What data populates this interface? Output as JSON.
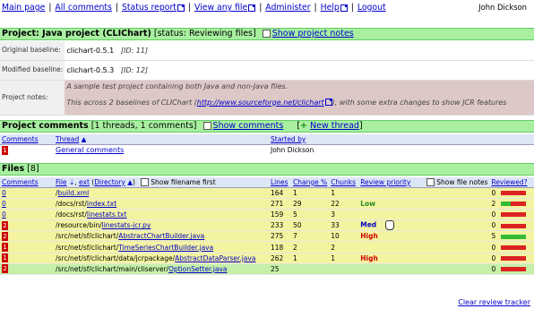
{
  "nav": {
    "items": [
      "Main page",
      "All comments",
      "Status report",
      "View any file",
      "Administer",
      "Help",
      "Logout"
    ],
    "user": "John Dickson"
  },
  "project": {
    "header_prefix": "Project: ",
    "name": "Java project (CLIChart)",
    "status": "[status: Reviewing files]",
    "show_notes": "Show project notes",
    "original_label": "Original baseline:",
    "original_value": "clichart-0.5.1",
    "original_id": "[ID: 11]",
    "modified_label": "Modified baseline:",
    "modified_value": "clichart-0.5.3",
    "modified_id": "[ID: 12]",
    "notes_label": "Project notes:",
    "notes_line1": "A sample test project containing both Java and non-Java files.",
    "notes_line2_pre": "This across 2 baselines of CLIChart (",
    "notes_link": "http://www.sourceforge.net/clichart",
    "notes_line2_post": "), with some extra changes to show JCR features"
  },
  "comments": {
    "title": "Project comments",
    "count": "[1 threads, 1 comments]",
    "show": "Show comments",
    "new_thread": "New thread",
    "col_comments": "Comments",
    "col_thread": "Thread",
    "col_started": "Started by",
    "rows": [
      {
        "count": "1",
        "thread": "General comments",
        "started_by": "John Dickson"
      }
    ]
  },
  "files": {
    "title": "Files",
    "count": "[8]",
    "col_comments": "Comments",
    "col_file": "File",
    "col_ext": "ext",
    "col_directory": "Directory",
    "show_filename_first": "Show filename first",
    "col_lines": "Lines",
    "col_change": "Change %",
    "col_chunks": "Chunks",
    "col_priority": "Review priority",
    "show_file_notes": "Show file notes",
    "col_reviewed": "Reviewed?",
    "rows": [
      {
        "comments": "0",
        "dir": "/",
        "file": "build.xml",
        "lines": "164",
        "change": "1",
        "chunks": "1",
        "priority": "",
        "reviewed": "0",
        "fill": 0,
        "green": false
      },
      {
        "comments": "0",
        "dir": "/docs/rst/",
        "file": "index.txt",
        "lines": "271",
        "change": "29",
        "chunks": "22",
        "priority": "Low",
        "reviewed": "2",
        "fill": 0.4,
        "green": false
      },
      {
        "comments": "0",
        "dir": "/docs/rst/",
        "file": "linestats.txt",
        "lines": "159",
        "change": "5",
        "chunks": "3",
        "priority": "",
        "reviewed": "0",
        "fill": 0,
        "green": false
      },
      {
        "comments": "2",
        "dir": "/resource/bin/",
        "file": "linestats-jcr.py",
        "lines": "233",
        "change": "50",
        "chunks": "33",
        "priority": "Med",
        "reviewed": "0",
        "fill": 0,
        "green": false
      },
      {
        "comments": "2",
        "dir": "/src/net/sf/clichart/",
        "file": "AbstractChartBuilder.java",
        "lines": "275",
        "change": "7",
        "chunks": "10",
        "priority": "High",
        "reviewed": "5",
        "fill": 1,
        "green": false
      },
      {
        "comments": "1",
        "dir": "/src/net/sf/clichart/",
        "file": "TimeSeriesChartBuilder.java",
        "lines": "118",
        "change": "2",
        "chunks": "2",
        "priority": "",
        "reviewed": "0",
        "fill": 0,
        "green": false
      },
      {
        "comments": "1",
        "dir": "/src/net/sf/clichart/data/jcrpackage/",
        "file": "AbstractDataParser.java",
        "lines": "262",
        "change": "1",
        "chunks": "1",
        "priority": "High",
        "reviewed": "0",
        "fill": 0,
        "green": false
      },
      {
        "comments": "2",
        "dir": "/src/net/sf/clichart/main/cliserver/",
        "file": "OptionSetter.java",
        "lines": "25",
        "change": "",
        "chunks": "",
        "priority": "",
        "reviewed": "0",
        "fill": 0,
        "green": true
      }
    ],
    "clear_tracker": "Clear review tracker"
  },
  "colors": {
    "header_green": "#a8f0a0",
    "row_yellow": "#f4f4a0",
    "row_green": "#c6f0a8",
    "badge_red": "#cc0000",
    "link_blue": "#0000cc"
  }
}
